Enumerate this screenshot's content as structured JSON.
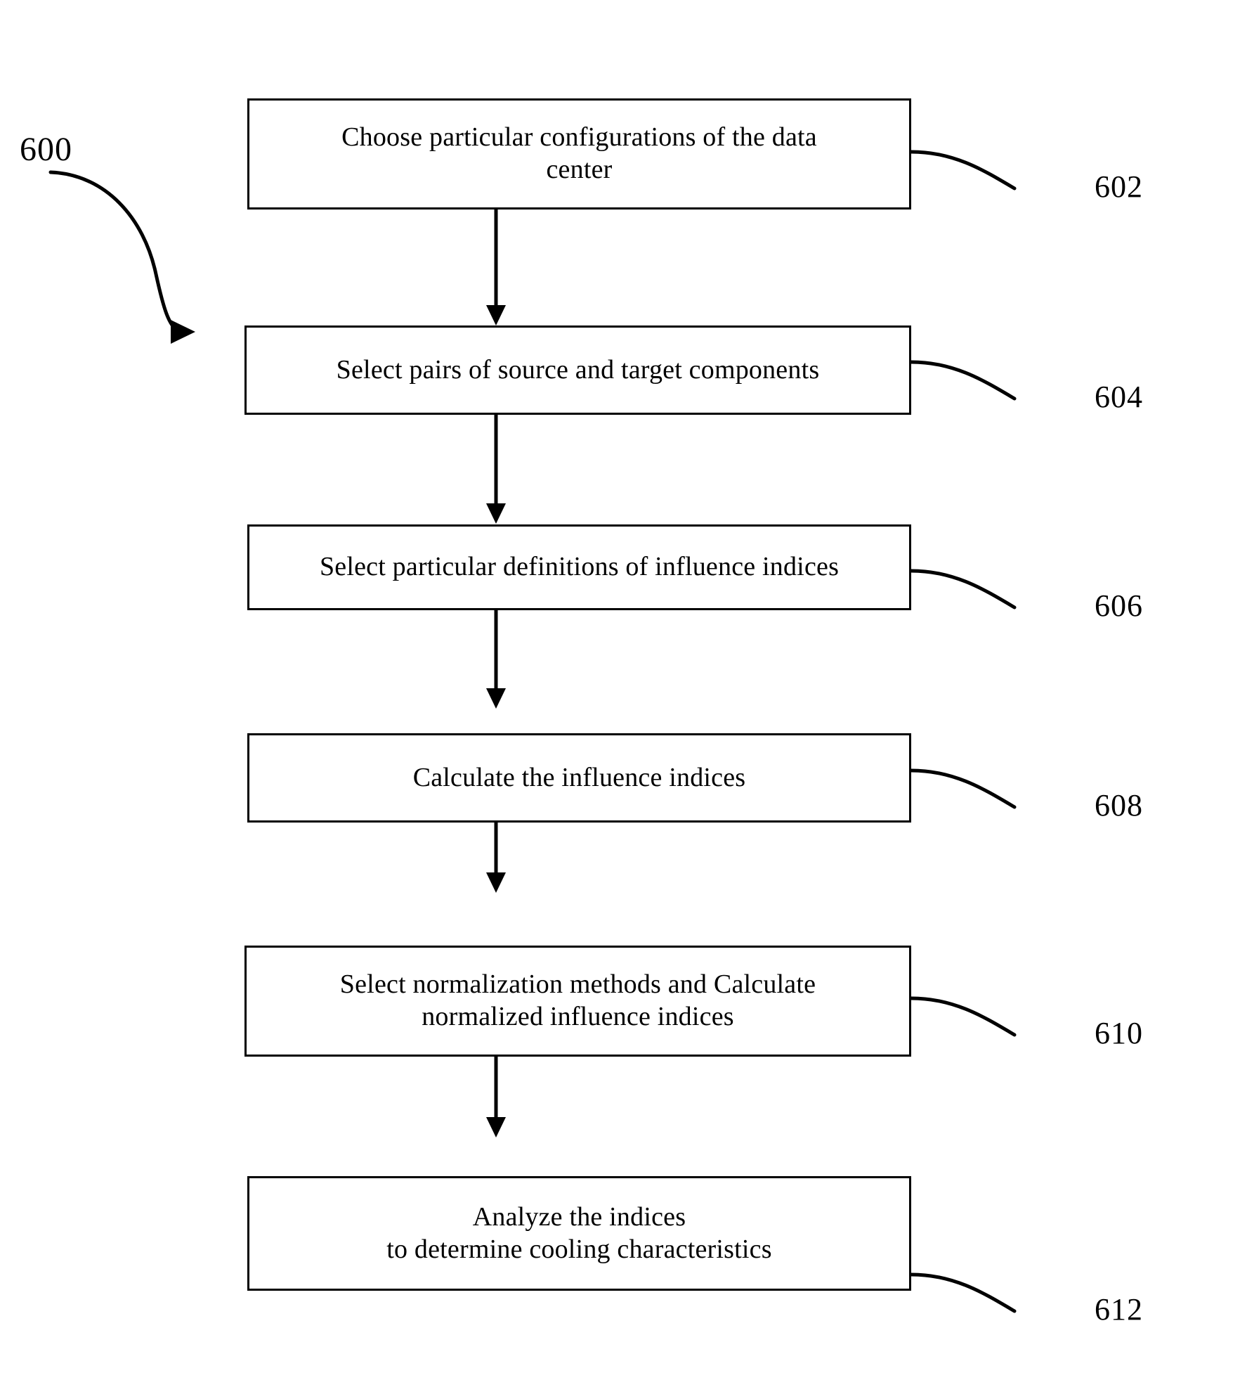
{
  "figure": {
    "figure_number": "600",
    "line_color": "#000000",
    "background_color": "#ffffff",
    "box_fill": "#ffffff"
  },
  "steps": [
    {
      "ref": "602",
      "text": "Choose particular configurations of the data\ncenter"
    },
    {
      "ref": "604",
      "text": "Select pairs of source and target components"
    },
    {
      "ref": "606",
      "text": "Select particular definitions of influence indices"
    },
    {
      "ref": "608",
      "text": "Calculate the influence indices"
    },
    {
      "ref": "610",
      "text": "Select normalization methods and Calculate\nnormalized influence indices"
    },
    {
      "ref": "612",
      "text": "Analyze the indices\nto determine cooling characteristics"
    }
  ]
}
